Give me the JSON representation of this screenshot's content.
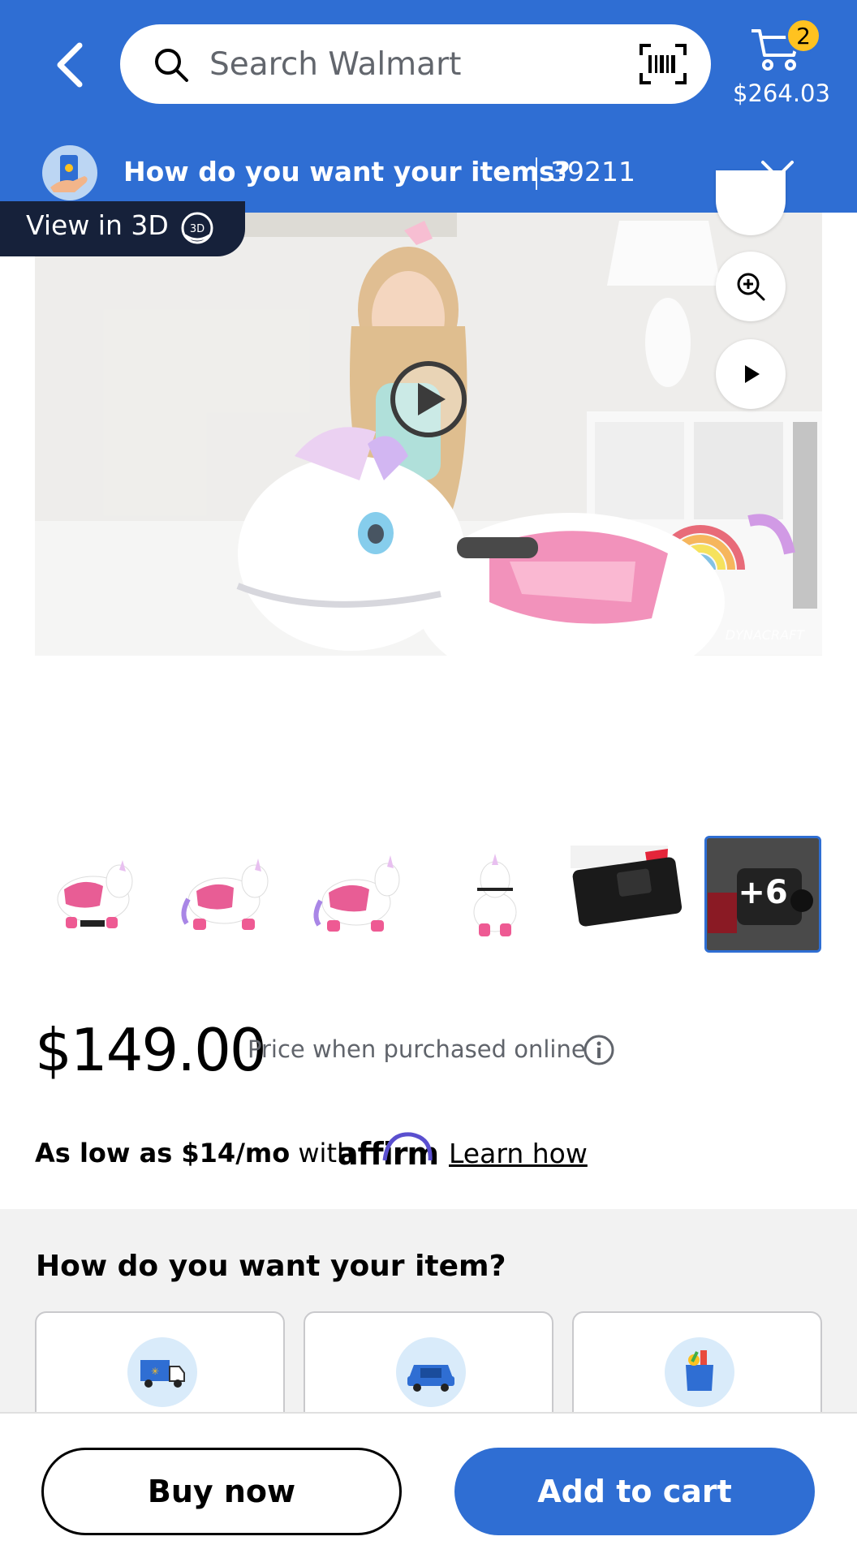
{
  "header": {
    "back_icon": "chevron-left-icon",
    "search": {
      "placeholder": "Search Walmart",
      "value": "",
      "icon": "search-icon",
      "scan_icon": "barcode-scan-icon"
    },
    "cart": {
      "icon": "cart-icon",
      "badge_count": "2",
      "total": "$264.03",
      "badge_color": "#ffc220"
    },
    "delivery": {
      "label": "How do you want your items?",
      "zip": "39211",
      "chevron_icon": "chevron-down-icon"
    },
    "brand_color": "#2f6ed3"
  },
  "gallery": {
    "view_3d_label": "View in 3D",
    "watermark": "DYNACRAFT",
    "more_images_label": "+6"
  },
  "pricing": {
    "price": "$149.00",
    "price_note": "Price when purchased online",
    "affirm_prefix": "As low as $14/mo",
    "affirm_with": "with",
    "affirm_brand": "affirm",
    "learn_how": "Learn how"
  },
  "fulfillment": {
    "title": "How do you want your item?",
    "options": [
      {
        "icon": "delivery-truck-icon"
      },
      {
        "icon": "car-pickup-icon"
      },
      {
        "icon": "walmart-bag-icon"
      }
    ]
  },
  "actions": {
    "buy_now": "Buy now",
    "add_to_cart": "Add to cart"
  }
}
